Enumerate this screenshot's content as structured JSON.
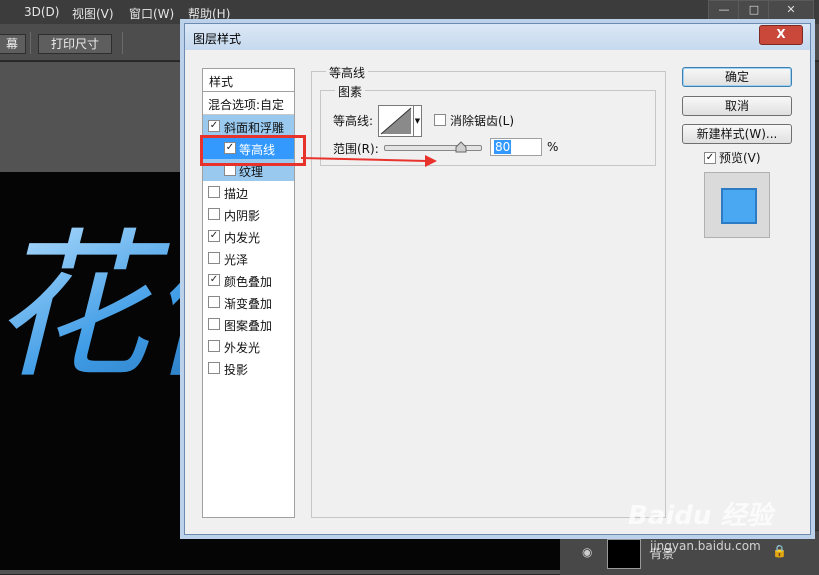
{
  "menu": [
    "3D(D)",
    "视图(V)",
    "窗口(W)",
    "帮助(H)"
  ],
  "options_bar": {
    "left_button": "幕",
    "print_size_button": "打印尺寸"
  },
  "layers_panel": {
    "layer_name": "背景"
  },
  "dialog": {
    "title": "图层样式",
    "close_label": "X",
    "styles_header": "样式",
    "blend_options": "混合选项:自定",
    "items": [
      {
        "label": "斜面和浮雕",
        "checked": true
      },
      {
        "label": "等高线",
        "checked": true
      },
      {
        "label": "纹理",
        "checked": false
      },
      {
        "label": "描边",
        "checked": false
      },
      {
        "label": "内阴影",
        "checked": false
      },
      {
        "label": "内发光",
        "checked": true
      },
      {
        "label": "光泽",
        "checked": false
      },
      {
        "label": "颜色叠加",
        "checked": true
      },
      {
        "label": "渐变叠加",
        "checked": false
      },
      {
        "label": "图案叠加",
        "checked": false
      },
      {
        "label": "外发光",
        "checked": false
      },
      {
        "label": "投影",
        "checked": false
      }
    ],
    "contour_group": "等高线",
    "elements_group": "图素",
    "contour_label": "等高线:",
    "anti_alias_label": "消除锯齿(L)",
    "anti_alias_checked": false,
    "range_label": "范围(R):",
    "range_value": "80",
    "range_unit": "%",
    "range_percent": 80,
    "buttons": {
      "ok": "确定",
      "cancel": "取消",
      "new_style": "新建样式(W)..."
    },
    "preview_label": "预览(V)",
    "preview_checked": true,
    "preview_color": "#4aa8f2"
  },
  "canvas_text": "花倾",
  "watermark": {
    "logo": "Baidu 经验",
    "site": "jingyan.baidu.com"
  },
  "colors": {
    "selection": "#3399ff",
    "selection_light": "#99c9ef",
    "annotation": "#e8332d"
  }
}
